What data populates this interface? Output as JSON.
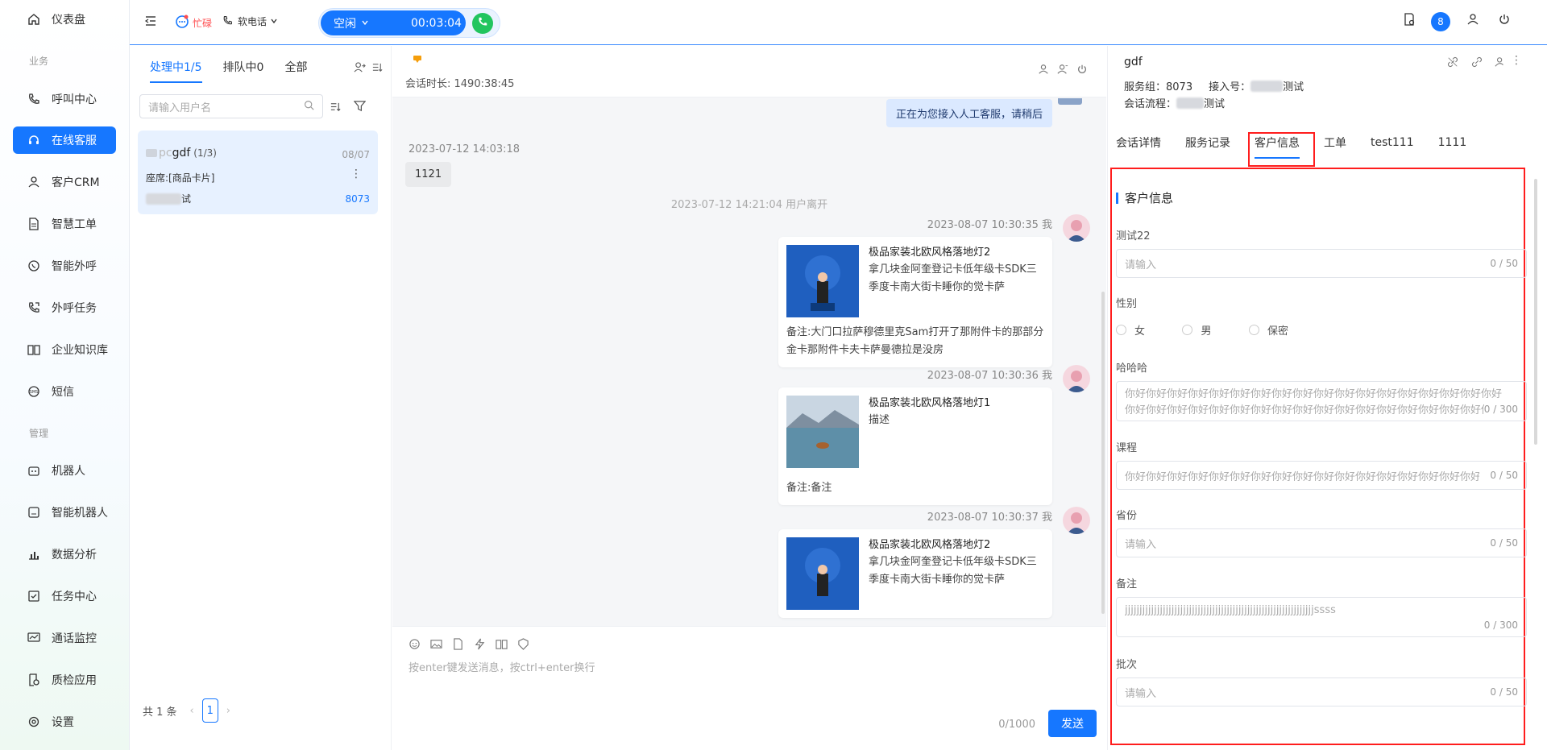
{
  "sidebar": {
    "items": [
      {
        "label": "仪表盘",
        "icon": "home-icon"
      },
      {
        "label": "呼叫中心",
        "icon": "phone-icon"
      },
      {
        "label": "在线客服",
        "icon": "headset-icon"
      },
      {
        "label": "客户CRM",
        "icon": "user-icon"
      },
      {
        "label": "智慧工单",
        "icon": "document-icon"
      },
      {
        "label": "智能外呼",
        "icon": "whatsapp-icon"
      },
      {
        "label": "外呼任务",
        "icon": "phone-forward-icon"
      },
      {
        "label": "企业知识库",
        "icon": "book-icon"
      },
      {
        "label": "短信",
        "icon": "sms-icon"
      },
      {
        "label": "机器人",
        "icon": "robot-icon"
      },
      {
        "label": "智能机器人",
        "icon": "smart-robot-icon"
      },
      {
        "label": "数据分析",
        "icon": "bar-chart-icon"
      },
      {
        "label": "任务中心",
        "icon": "task-icon"
      },
      {
        "label": "通话监控",
        "icon": "monitor-icon"
      },
      {
        "label": "质检应用",
        "icon": "inspection-icon"
      },
      {
        "label": "设置",
        "icon": "settings-icon"
      }
    ],
    "section_business": "业务",
    "section_manage": "管理"
  },
  "topbar": {
    "status": "忙碌",
    "soft_phone": "软电话",
    "idle_label": "空闲",
    "timer": "00:03:04",
    "badge_count": "8"
  },
  "sessions": {
    "tabs": [
      "处理中1/5",
      "排队中0",
      "全部"
    ],
    "search_placeholder": "请输入用户名",
    "card": {
      "prefix": "pc",
      "name": "gdf",
      "count": "(1/3)",
      "date": "08/07",
      "seat": "座席:[商品卡片]",
      "suffix": "试",
      "group": "8073"
    },
    "pager": {
      "total": "共 1 条",
      "page": "1"
    }
  },
  "chat": {
    "duration": "会话时长: 1490:38:45",
    "system_msg": "正在为您接入人工客服，请稍后",
    "msg1_time": "2023-07-12 14:03:18",
    "msg1_text": "1121",
    "leave_notice": "2023-07-12 14:21:04 用户离开",
    "cards": [
      {
        "time": "2023-08-07 10:30:35 我",
        "title": "极品家装北欧风格落地灯2",
        "desc": "拿几块金阿奎登记卡低年级卡SDK三季度卡南大街卡睡你的觉卡萨",
        "note": "备注:大门口拉萨穆德里克Sam打开了那附件卡的那部分金卡那附件卡夫卡萨曼德拉是没房"
      },
      {
        "time": "2023-08-07 10:30:36 我",
        "title": "极品家装北欧风格落地灯1",
        "desc": "描述",
        "note": "备注:备注"
      },
      {
        "time": "2023-08-07 10:30:37 我",
        "title": "极品家装北欧风格落地灯2",
        "desc": "拿几块金阿奎登记卡低年级卡SDK三季度卡南大街卡睡你的觉卡萨",
        "note": ""
      }
    ],
    "composer_placeholder": "按enter键发送消息，按ctrl+enter换行",
    "counter": "0/1000",
    "send": "发送"
  },
  "rpanel": {
    "name": "gdf",
    "service_group": "服务组：8073",
    "access_label": "接入号：",
    "access_suffix": "测试",
    "flow_label": "会话流程：",
    "flow_suffix": "测试",
    "tabs": [
      "会话详情",
      "服务记录",
      "客户信息",
      "工单",
      "test111",
      "1111"
    ],
    "section_title": "客户信息",
    "fields": {
      "test22_label": "测试22",
      "test22_placeholder": "请输入",
      "test22_counter": "0 / 50",
      "gender_label": "性别",
      "gender_options": [
        "女",
        "男",
        "保密"
      ],
      "hahaha_label": "哈哈哈",
      "hahaha_value": "你好你好你好你好你好你好你好你好你好你好你好你好你好你好你好你好你好你好你好你好你好你好你好你好你好你好你好你好你好你好你好你好你好你好你好你好你好你好你好你好你好你好你好你好你",
      "hahaha_counter": "0 / 300",
      "course_label": "课程",
      "course_value": "你好你好你好你好你好你好你好你好你好你好你好你好你好你好你好你好你好你好你",
      "course_counter": "0 / 50",
      "province_label": "省份",
      "province_placeholder": "请输入",
      "province_counter": "0 / 50",
      "remark_label": "备注",
      "remark_value": "jjjjjjjjjjjjjjjjjjjjjjjjjjjjjjjjjjjjjjjjjjjjjjjjjjjjjjjjjjjjjjjjjssss",
      "remark_counter": "0 / 300",
      "batch_label": "批次",
      "batch_placeholder": "请输入",
      "batch_counter": "0 / 50"
    }
  },
  "colors": {
    "accent": "#1677ff",
    "highlight": "#ff1d1d",
    "busy": "#ff4d4f",
    "call_green": "#22c55e"
  }
}
